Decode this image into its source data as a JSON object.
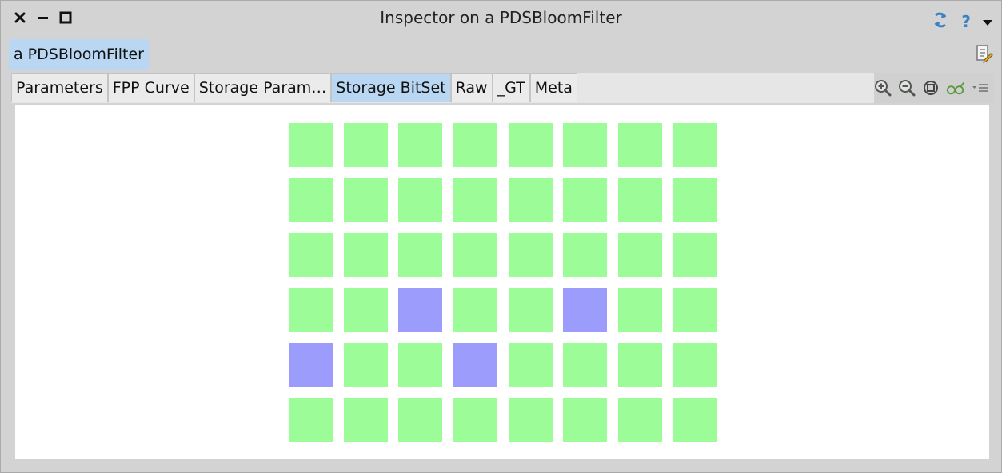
{
  "window": {
    "title": "Inspector on a PDSBloomFilter",
    "controls": [
      "close-icon",
      "minimize-icon",
      "maximize-icon"
    ],
    "right_icons": [
      "refresh-icon",
      "help-icon",
      "menu-down-icon"
    ],
    "help_glyph": "?"
  },
  "object_tab": {
    "label": "a PDSBloomFilter"
  },
  "tabs": [
    {
      "label": "Parameters",
      "selected": false
    },
    {
      "label": "FPP Curve",
      "selected": false
    },
    {
      "label": "Storage Param…",
      "selected": false
    },
    {
      "label": "Storage BitSet",
      "selected": true
    },
    {
      "label": "Raw",
      "selected": false
    },
    {
      "label": "_GT",
      "selected": false
    },
    {
      "label": "Meta",
      "selected": false
    }
  ],
  "toolbar": {
    "icons": [
      "zoom-in-icon",
      "zoom-out-icon",
      "zoom-fit-icon",
      "glasses-icon",
      "dropdown-menu-icon"
    ]
  },
  "colors": {
    "bit_off": "#9cfc98",
    "bit_on": "#9c9cfc",
    "tab_selected": "#b9d7f3"
  },
  "bitset": {
    "columns": 8,
    "rows": 6,
    "set_bits": [
      26,
      29,
      32,
      35
    ]
  }
}
